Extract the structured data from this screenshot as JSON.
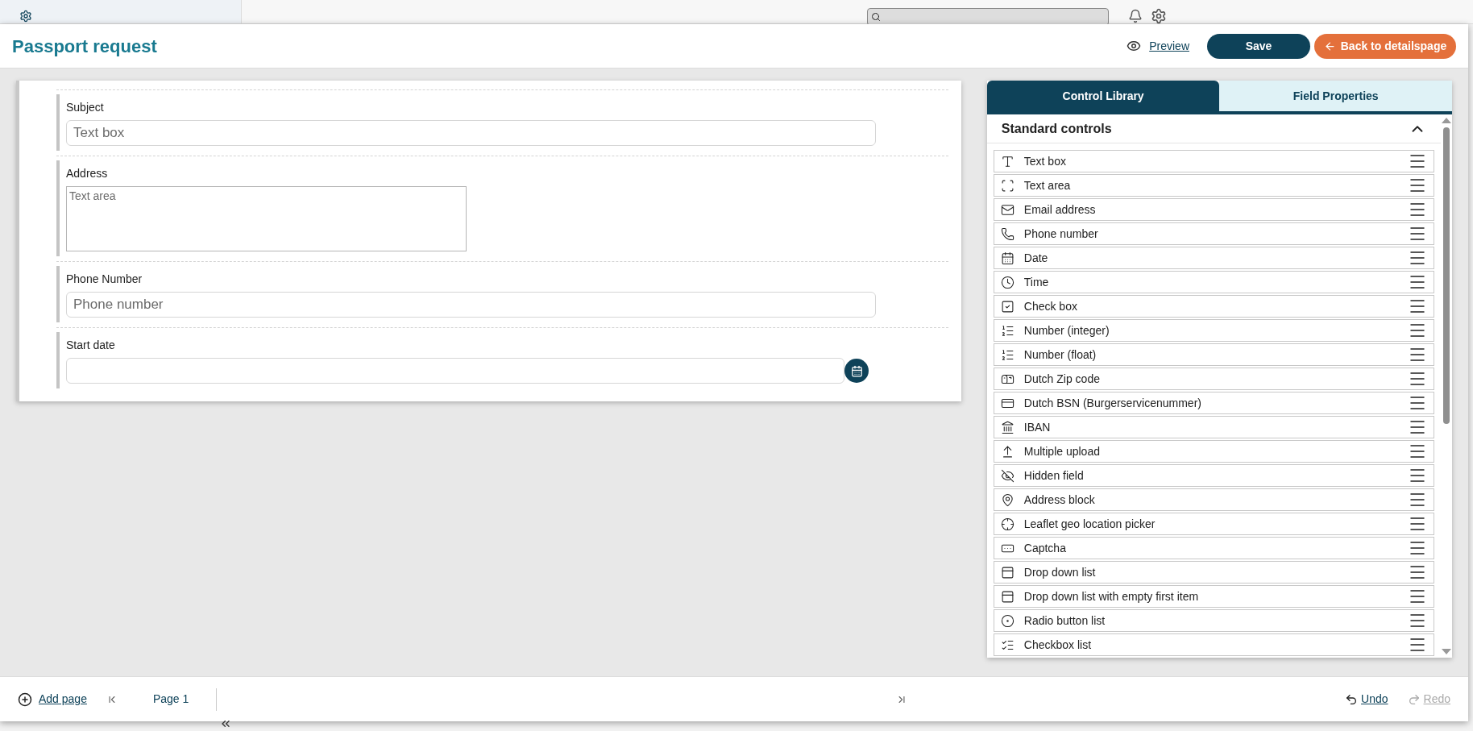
{
  "header": {
    "title": "Passport request",
    "preview": "Preview",
    "save": "Save",
    "back": "Back to detailspage"
  },
  "form_fields": [
    {
      "kind": "textbox",
      "label": "Subject",
      "placeholder": "Text box"
    },
    {
      "kind": "textarea",
      "label": "Address",
      "placeholder": "Text area"
    },
    {
      "kind": "textbox",
      "label": "Phone Number",
      "placeholder": "Phone number"
    },
    {
      "kind": "date",
      "label": "Start date"
    }
  ],
  "panel": {
    "tabs": [
      {
        "label": "Control Library",
        "selected": true
      },
      {
        "label": "Field Properties",
        "selected": false
      }
    ],
    "section": {
      "title": "Standard controls",
      "expanded": true
    },
    "controls": [
      "Text box",
      "Text area",
      "Email address",
      "Phone number",
      "Date",
      "Time",
      "Check box",
      "Number (integer)",
      "Number (float)",
      "Dutch Zip code",
      "Dutch BSN (Burgerservicenummer)",
      "IBAN",
      "Multiple upload",
      "Hidden field",
      "Address block",
      "Leaflet geo location picker",
      "Captcha",
      "Drop down list",
      "Drop down list with empty first item",
      "Radio button list",
      "Checkbox list"
    ]
  },
  "footer": {
    "add_page": "Add page",
    "page": "Page 1",
    "undo": "Undo",
    "redo": "Redo"
  }
}
